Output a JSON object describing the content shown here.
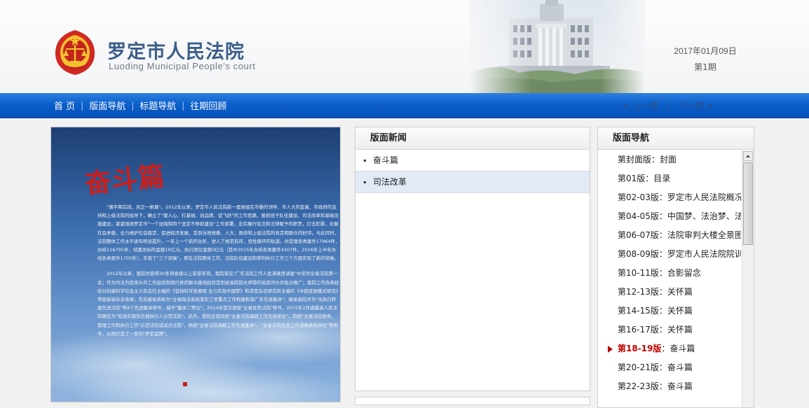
{
  "header": {
    "title": "罗定市人民法院",
    "subtitle": "Luoding Municipal People's court",
    "date": "2017年01月09日",
    "issue": "第1期"
  },
  "nav": {
    "links": [
      "首 页",
      "版面导航",
      "标题导航",
      "往期回顾"
    ],
    "prev": "上一期",
    "next": "下一期"
  },
  "page_image": {
    "calligraphy_title": "奋斗篇",
    "p1": "\"潮平两岸阔，风正一帆悬\"。2012年以来，罗定市人民法院新一届党组在市委的领导、市人大的监督、市政府的支持和上级法院的指导下，确立了\"聚人心、打基础、创品牌、促飞跃\"的工作思路，狠抓班子队伍建设、司法改革和基础设施建设，紧紧围绕罗定市\"一个加强和四个坚定不移抓建设\"工作部署，忠实履行宪法和法律赋予的职责，打击犯罪，化解社会矛盾，全力维护社会稳定，促进经济发展，受到当地党委、人大、政府和上级法院的肯定和群众的好评。与此同时，法院整体工作水平逐年明显提升，一年上一个新的台阶，进入了规范有序、良性循环的轨道。共受理各类案件17964件，办结116795件，结案总标的金额19亿元，执行到位金额3亿元（其中2015年办结各类案件4307件，2016年上半年办结各类案件1705件），实现了\"三个突破\"，即在法院整体工作、法院队伍建设和审判执行工作三个方面实现了新的突破。",
    "p2": "2012年以来，我院共获得30多项省级以上荣誉奖项。我院曾在\"广东法院工作人民满意度调查\"中名列全省法院第一名；作为司法为民排头兵工作经验和践行党的群众路线经验受到省高院院长郑鄂的高度评价并批示推广；我院工作改革经验分别被科学社会主义杂志社主编的《坚持科学发展观 全力实现中国梦》和求是杂志研究所主编的《中国发展模式研究》等国家级杂志收录；先后被省表彰为\"全省政法系统落实三项重点工作构建和谐广东先进集体\"；被省高院评为\"无执行积案先进法院\"等8个先进集体称号，授予\"集体二等功\"；2014年首次获授\"全省优秀法院\"称号，2015年2月被最高人民法院确定为\"有效实施先信被执行人示范法院\"。此外，我院还曾四获\"全省法院调研工作先进单位\"，四获\"全省法院政务、管理工作和执行工作\"示范法院或试点法院\"，两获\"全省法院调解工作先进集体\"、\"全省法院信息工作通报表扬单位\"等称号，从而打造了一系列\"罗定品牌\"。"
  },
  "news_panel": {
    "title": "版面新闻",
    "items": [
      "奋斗篇",
      "司法改革"
    ],
    "selected_index": 1
  },
  "pages_panel": {
    "title": "版面导航",
    "current_index": 10,
    "items": [
      {
        "num": "第封面版",
        "name": "封面"
      },
      {
        "num": "第01版",
        "name": "目录"
      },
      {
        "num": "第02-03版",
        "name": "罗定市人民法院概况"
      },
      {
        "num": "第04-05版",
        "name": "中国梦、法治梦、法院梦"
      },
      {
        "num": "第06-07版",
        "name": "法院审判大楼全景图"
      },
      {
        "num": "第08-09版",
        "name": "罗定市人民法院院训"
      },
      {
        "num": "第10-11版",
        "name": "合影留念"
      },
      {
        "num": "第12-13版",
        "name": "关怀篇"
      },
      {
        "num": "第14-15版",
        "name": "关怀篇"
      },
      {
        "num": "第16-17版",
        "name": "关怀篇"
      },
      {
        "num": "第18-19版",
        "name": "奋斗篇"
      },
      {
        "num": "第20-21版",
        "name": "奋斗篇"
      },
      {
        "num": "第22-23版",
        "name": "奋斗篇"
      }
    ]
  },
  "colors": {
    "nav_blue": "#0c5fcb",
    "title_blue": "#3b5e8a",
    "current_red": "#c00000"
  }
}
